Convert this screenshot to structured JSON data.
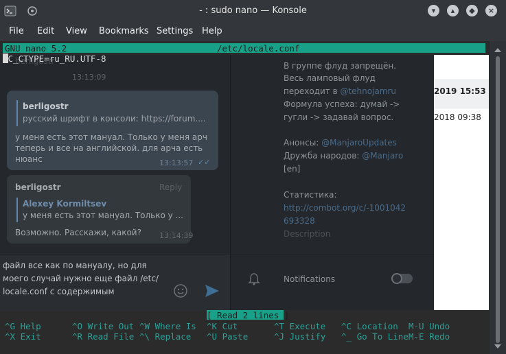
{
  "window": {
    "title": "- : sudo nano — Konsole",
    "buttons": [
      "▾",
      "▴",
      "×"
    ]
  },
  "menu": [
    "File",
    "Edit",
    "View",
    "Bookmarks",
    "Settings",
    "Help"
  ],
  "nano": {
    "version": "GNU nano 5.2",
    "filename": "/etc/locale.conf",
    "content_line": "LC_CTYPE=ru_RU.UTF-8",
    "status": "[ Read 2 lines ]",
    "shortcuts_row1": [
      {
        "key": "^G",
        "label": "Help"
      },
      {
        "key": "^O",
        "label": "Write Out"
      },
      {
        "key": "^W",
        "label": "Where Is"
      },
      {
        "key": "^K",
        "label": "Cut"
      },
      {
        "key": "^T",
        "label": "Execute"
      },
      {
        "key": "^C",
        "label": "Location"
      },
      {
        "key": "M-U",
        "label": "Undo"
      }
    ],
    "shortcuts_row2": [
      {
        "key": "^X",
        "label": "Exit"
      },
      {
        "key": "^R",
        "label": "Read File"
      },
      {
        "key": "^\\",
        "label": "Replace"
      },
      {
        "key": "^U",
        "label": "Paste"
      },
      {
        "key": "^J",
        "label": "Justify"
      },
      {
        "key": "^_",
        "label": "Go To Line"
      },
      {
        "key": "M-E",
        "label": "Redo"
      }
    ]
  },
  "telegram": {
    "top_faded_name": "berligostr",
    "msg1_time": "13:13:09",
    "msg1_sender": "berligostr",
    "msg1_quote": "русский шрифт в консоли: https://forum....",
    "msg1_text1": "у меня есть этот мануал. Только у меня арч",
    "msg1_text2": "теперь и все на английской. для арча есть",
    "msg1_text3": "нюанс",
    "msg1_time2": "13:13:57",
    "msg2_sender": "berligostr",
    "msg2_reply": "Reply",
    "msg2_quote_author": "Alexey Kormiltsev",
    "msg2_quote_text": "у меня есть этот мануал. Только у ...",
    "msg2_text": "Возможно. Расскажи, какой?",
    "msg2_time": "13:14:39",
    "input_line1": "файл все как по мануалу, но для",
    "input_line2": "моего случай нужно еще файл /etc/",
    "input_line3": "locale.conf с содержимым",
    "info": {
      "rules1": "В группе флуд запрещён.",
      "rules2": "Весь ламповый флуд",
      "rules3a": "переходит в ",
      "rules3b": "@tehnojamru",
      "rules4": "Формула успеха: думай ->",
      "rules5": "гугли -> задавай вопрос.",
      "ann_a": "Анонсы: ",
      "ann_b": "@ManjaroUpdates",
      "friend_a": "Дружба народов: ",
      "friend_b": "@Manjaro",
      "en": "[en]",
      "stats": "Статистика:",
      "link1": "http://combot.org/c/-1001042",
      "link2": "693328",
      "description": "Description",
      "notifications": "Notifications"
    },
    "bg_date1": "2019 15:53",
    "bg_date2": "2018 09:38"
  }
}
